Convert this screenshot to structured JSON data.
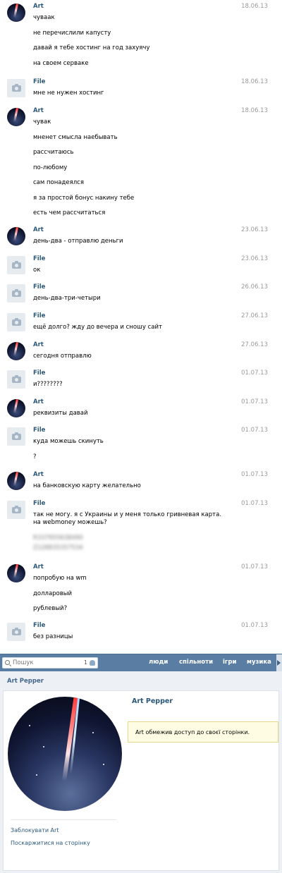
{
  "messages": [
    {
      "author": "Art",
      "date": "18.06.13",
      "lines": [
        "чуваак",
        "не перечислили капусту",
        "давай я тебе хостинг на год захуячу",
        "на своем серваке"
      ]
    },
    {
      "author": "File",
      "date": "18.06.13",
      "lines": [
        "мне не нужен хостинг"
      ]
    },
    {
      "author": "Art",
      "date": "18.06.13",
      "lines": [
        "чувак",
        "мненет смысла наебывать",
        "рассчитаюсь",
        "по-любому",
        "сам понадеялся",
        "я за простой бонус накину тебе",
        "есть чем рассчитаться"
      ]
    },
    {
      "author": "Art",
      "date": "23.06.13",
      "lines": [
        "день-два - отправлю деньги"
      ]
    },
    {
      "author": "File",
      "date": "23.06.13",
      "lines": [
        "ок"
      ]
    },
    {
      "author": "File",
      "date": "26.06.13",
      "lines": [
        "день-два-три-четыри"
      ]
    },
    {
      "author": "File",
      "date": "27.06.13",
      "lines": [
        "ещё долго? жду до вечера и сношу сайт"
      ]
    },
    {
      "author": "Art",
      "date": "27.06.13",
      "lines": [
        "сегодня отправлю"
      ]
    },
    {
      "author": "File",
      "date": "01.07.13",
      "lines": [
        "и????????"
      ]
    },
    {
      "author": "Art",
      "date": "01.07.13",
      "lines": [
        "реквизиты давай"
      ]
    },
    {
      "author": "File",
      "date": "01.07.13",
      "lines": [
        "куда можешь скинуть",
        "?"
      ]
    },
    {
      "author": "Art",
      "date": "01.07.13",
      "lines": [
        "на банковскую карту желательно"
      ]
    },
    {
      "author": "File",
      "date": "01.07.13",
      "lines": [
        "так не могу. я с Украины и у меня только гривневая карта. на webmoney можешь?"
      ],
      "blurred": [
        "R337955638490",
        "Z128835357534"
      ]
    },
    {
      "author": "Art",
      "date": "01.07.13",
      "lines": [
        "попробую на wm",
        "долларовый",
        "рублевый?"
      ]
    },
    {
      "author": "File",
      "date": "01.07.13",
      "lines": [
        "без разницы"
      ]
    }
  ],
  "topbar": {
    "search_placeholder": "Пошук",
    "search_count": "1",
    "nav": [
      "люди",
      "спільноти",
      "ігри",
      "музика"
    ]
  },
  "profile": {
    "header_name": "Art Pepper",
    "name": "Art Pepper",
    "notice": "Art обмежив доступ до своєї сторінки.",
    "links": [
      "Заблокувати Art",
      "Поскаржитися на сторінку"
    ]
  },
  "colors": {
    "link": "#2b587a",
    "topbar": "#5a7ea3",
    "highlight": "#edf1f5",
    "notice_bg": "#fefde3"
  }
}
